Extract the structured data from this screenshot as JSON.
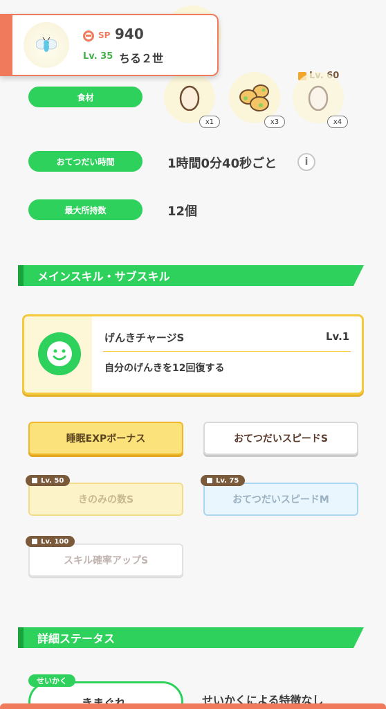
{
  "pokemon": {
    "sp_label": "SP",
    "sp_value": "940",
    "lv_label": "Lv. 35",
    "name": "ちる２世"
  },
  "rows": {
    "ingredients_label": "食材",
    "help_time_label": "おてつだい時間",
    "help_time_value": "1時間0分40秒ごと",
    "max_carry_label": "最大所持数",
    "max_carry_value": "12個"
  },
  "ingredients": [
    {
      "icon": "egg-icon",
      "count": "x1"
    },
    {
      "icon": "potato-icon",
      "count": "x3"
    },
    {
      "icon": "egg-icon",
      "count": "x4",
      "lock_level": "Lv. 60"
    }
  ],
  "info_icon_glyph": "i",
  "sections": {
    "skills_title": "メインスキル・サブスキル",
    "details_title": "詳細ステータス"
  },
  "main_skill": {
    "name": "げんきチャージS",
    "level": "Lv.1",
    "description": "自分のげんきを12回復する"
  },
  "sub_skills": [
    {
      "label": "睡眠EXPボーナス",
      "style": "gold",
      "unlock": ""
    },
    {
      "label": "おてつだいスピードS",
      "style": "white",
      "unlock": ""
    },
    {
      "label": "きのみの数S",
      "style": "gold-locked",
      "unlock": "Lv. 50"
    },
    {
      "label": "おてつだいスピードM",
      "style": "blue-locked",
      "unlock": "Lv. 75"
    },
    {
      "label": "スキル確率アップS",
      "style": "white-locked",
      "unlock": "Lv. 100"
    }
  ],
  "nature": {
    "tag": "せいかく",
    "value": "きまぐれ",
    "description": "せいかくによる特徴なし"
  },
  "colors": {
    "accent_green": "#2ed15c",
    "accent_orange": "#f07a5c",
    "gold": "#f4c93a"
  }
}
